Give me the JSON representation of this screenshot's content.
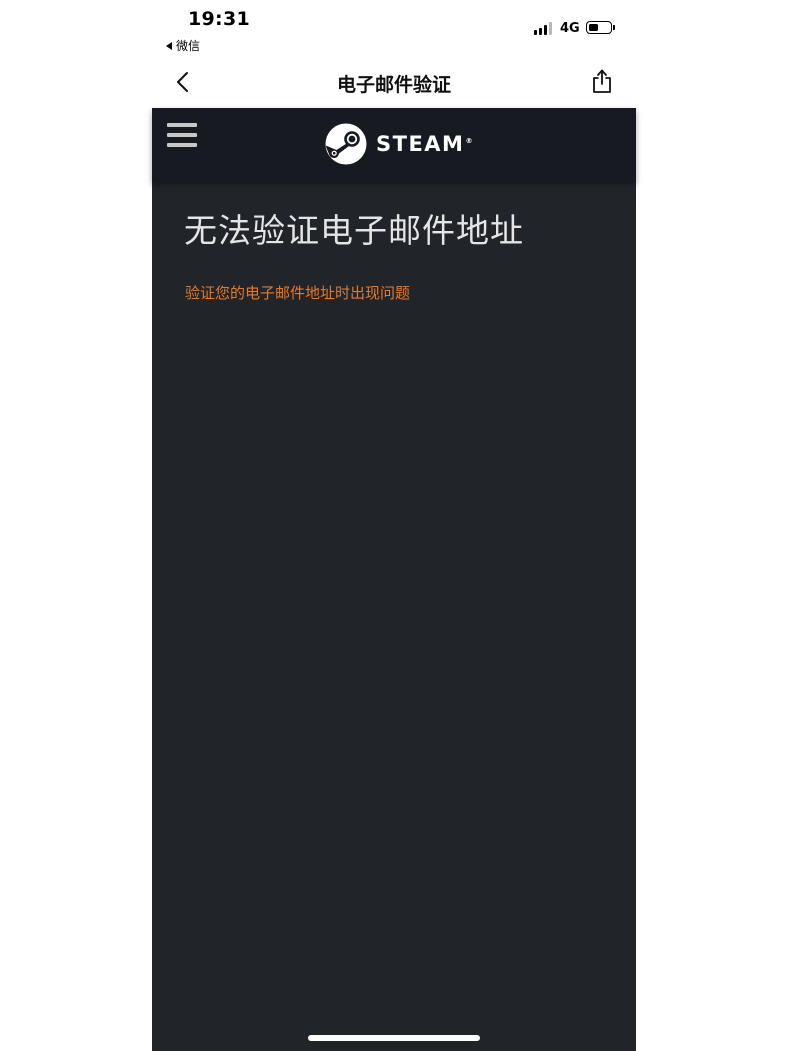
{
  "status_bar": {
    "time": "19:31",
    "back_app_label": "微信",
    "network": "4G",
    "battery_level": 0.45
  },
  "nav": {
    "title": "电子邮件验证",
    "back_icon": "chevron-left-icon",
    "share_icon": "share-icon"
  },
  "header": {
    "brand": "STEAM",
    "brand_mark": "®",
    "menu_icon": "hamburger-icon",
    "colors": {
      "header_bg": "#171a21",
      "page_bg": "#212429",
      "error_text": "#e57a29"
    }
  },
  "main": {
    "heading": "无法验证电子邮件地址",
    "error_message": "验证您的电子邮件地址时出现问题"
  }
}
